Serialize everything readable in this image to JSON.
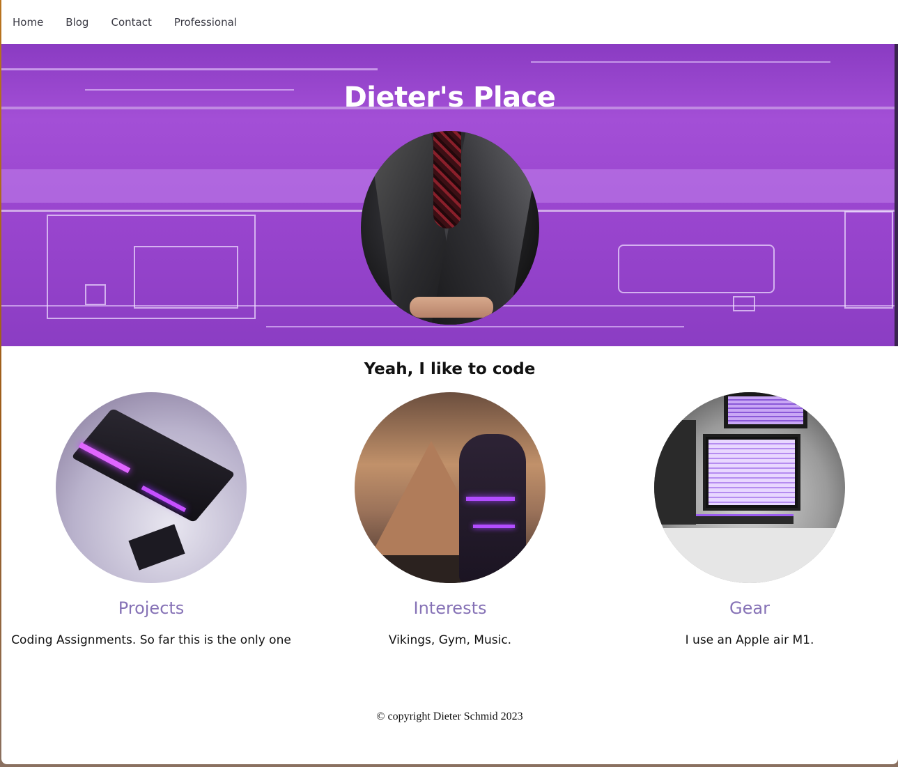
{
  "nav": {
    "items": [
      {
        "label": "Home"
      },
      {
        "label": "Blog"
      },
      {
        "label": "Contact"
      },
      {
        "label": "Professional"
      }
    ]
  },
  "hero": {
    "title": "Dieter's Place",
    "accent_color": "#9a46cf"
  },
  "main": {
    "tagline": "Yeah, I like to code",
    "cards": [
      {
        "title": "Projects",
        "description": "Coding Assignments. So far this is the only one"
      },
      {
        "title": "Interests",
        "description": "Vikings, Gym, Music."
      },
      {
        "title": "Gear",
        "description": "I use an Apple air M1."
      }
    ],
    "card_title_color": "#8672b6"
  },
  "footer": {
    "copyright": "© copyright Dieter Schmid 2023"
  }
}
